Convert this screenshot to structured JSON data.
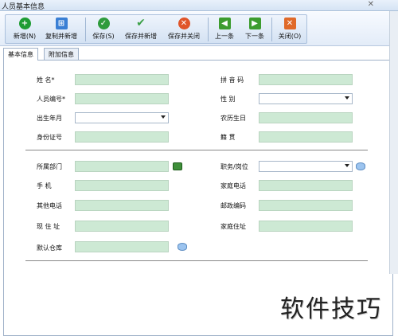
{
  "window": {
    "title": "人员基本信息"
  },
  "toolbar": {
    "buttons": [
      {
        "label": "新增(N)",
        "icon": "plus-icon",
        "color": "#1f9c33"
      },
      {
        "label": "复制并新增",
        "icon": "copy-plus-icon",
        "color": "#3a7fd4"
      },
      {
        "label": "保存(S)",
        "icon": "check-icon",
        "color": "#2e9b3c"
      },
      {
        "label": "保存并新增",
        "icon": "checkmark-icon",
        "color": "#3ea14a"
      },
      {
        "label": "保存并关闭",
        "icon": "close-circle-icon",
        "color": "#e0552a"
      },
      {
        "label": "上一条",
        "icon": "arrow-left-icon",
        "color": "#3d9c2f"
      },
      {
        "label": "下一条",
        "icon": "arrow-right-icon",
        "color": "#3d9c2f"
      },
      {
        "label": "关闭(O)",
        "icon": "close-square-icon",
        "color": "#e06a2a"
      }
    ]
  },
  "tabs": [
    {
      "label": "基本信息",
      "active": true
    },
    {
      "label": "附加信息",
      "active": false
    }
  ],
  "form": {
    "name_label": "姓    名",
    "pinyin_label": "拼 音 码",
    "emp_no_label": "人员编号",
    "gender_label": "性    别",
    "birth_label": "出生年月",
    "lunar_label": "农历生日",
    "id_label": "身份证号",
    "origin_label": "籍    贯",
    "dept_label": "所属部门",
    "position_label": "职务/岗位",
    "mobile_label": "手    机",
    "home_phone_label": "家庭电话",
    "other_phone_label": "其他电话",
    "zip_label": "邮政编码",
    "address_label": "现 住 址",
    "home_address_label": "家庭住址",
    "warehouse_label": "默认仓库",
    "required_mark": "*"
  },
  "watermark": "软件技巧"
}
